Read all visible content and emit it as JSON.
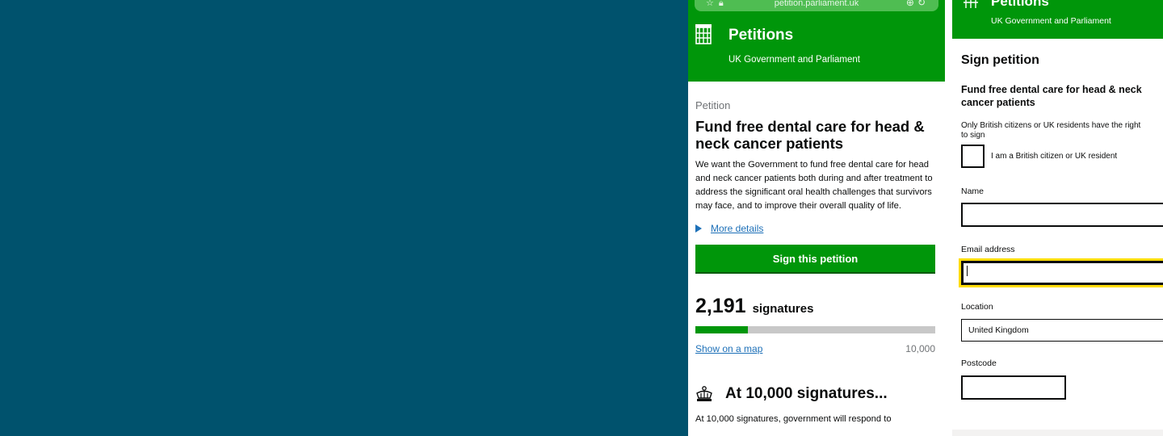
{
  "colors": {
    "background": "#00526d",
    "brand_green": "#00960a",
    "link_blue": "#1d70b8",
    "focus_yellow": "#ffdd00"
  },
  "left_screen": {
    "browser": {
      "url": "petition.parliament.uk",
      "left_icons": [
        "bookmark-icon",
        "lock-icon"
      ],
      "right_icons": [
        "add-tab-icon",
        "reload-icon"
      ]
    },
    "header": {
      "logo_icon": "portcullis-icon",
      "brand": "Petitions",
      "subtitle": "UK Government and Parliament"
    },
    "caption": "Petition",
    "title": "Fund free dental care for head & neck cancer patients",
    "description": "We want the Government to fund free dental care for head and neck cancer patients both during and after treatment to address the significant oral health challenges that survivors may face, and to improve their overall quality of life.",
    "more_details": "More details",
    "sign_button": "Sign this petition",
    "signatures": {
      "count": "2,191",
      "label": "signatures",
      "progress_fraction": 0.219
    },
    "map_link": "Show on a map",
    "target": "10,000",
    "threshold": {
      "icon": "crown-icon",
      "title": "At 10,000 signatures...",
      "text": "At 10,000 signatures, government will respond to"
    }
  },
  "right_screen": {
    "header": {
      "logo_icon": "portcullis-icon",
      "brand": "Petitions",
      "subtitle": "UK Government and Parliament"
    },
    "heading": "Sign petition",
    "petition_title_line1": "Fund free dental care for head & neck",
    "petition_title_line2": "cancer patients",
    "eligibility_line1": "Only British citizens or UK residents have the right",
    "eligibility_line2": "to sign",
    "checkbox_label": "I am a British citizen or UK resident",
    "fields": {
      "name_label": "Name",
      "name_value": "",
      "email_label": "Email address",
      "email_value": "",
      "location_label": "Location",
      "location_value": "United Kingdom",
      "postcode_label": "Postcode",
      "postcode_value": ""
    }
  }
}
